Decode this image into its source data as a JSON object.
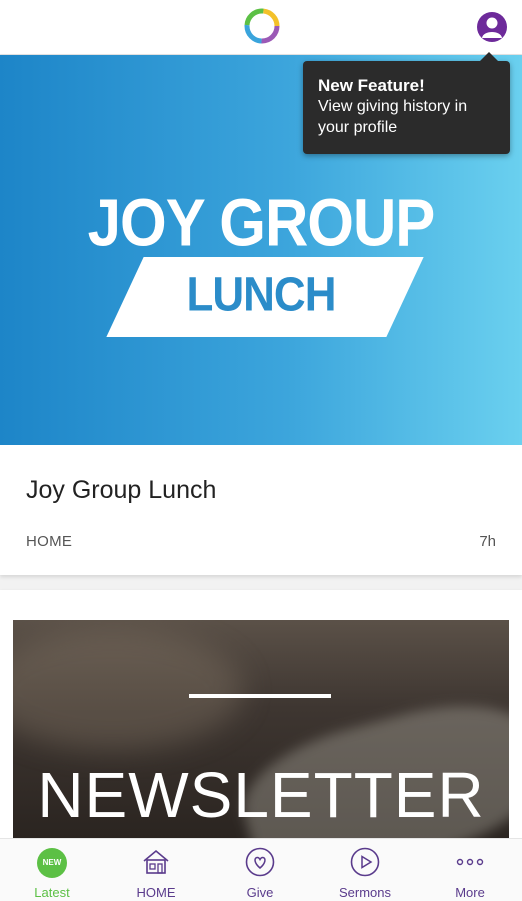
{
  "tooltip": {
    "title": "New Feature!",
    "line1": "View giving history in",
    "line2": "your profile"
  },
  "feed": [
    {
      "hero_title": "JOY GROUP",
      "hero_sub": "LUNCH",
      "title": "Joy Group Lunch",
      "category": "HOME",
      "time": "7h"
    },
    {
      "hero_text": "NEWSLETTER"
    }
  ],
  "tabbar": {
    "badge": "NEW",
    "items": [
      "Latest",
      "HOME",
      "Give",
      "Sermons",
      "More"
    ]
  },
  "icons": {
    "logo": "ring-logo-icon",
    "profile": "user-icon",
    "home": "house-icon",
    "give": "heart-icon",
    "sermons": "play-icon",
    "more": "ellipsis-icon"
  },
  "colors": {
    "accent_purple": "#5a3b8c",
    "active_green": "#5cc045",
    "hero_blue_start": "#1d85c8",
    "hero_blue_end": "#6ad0ef",
    "tooltip_bg": "#2b2b2b"
  }
}
